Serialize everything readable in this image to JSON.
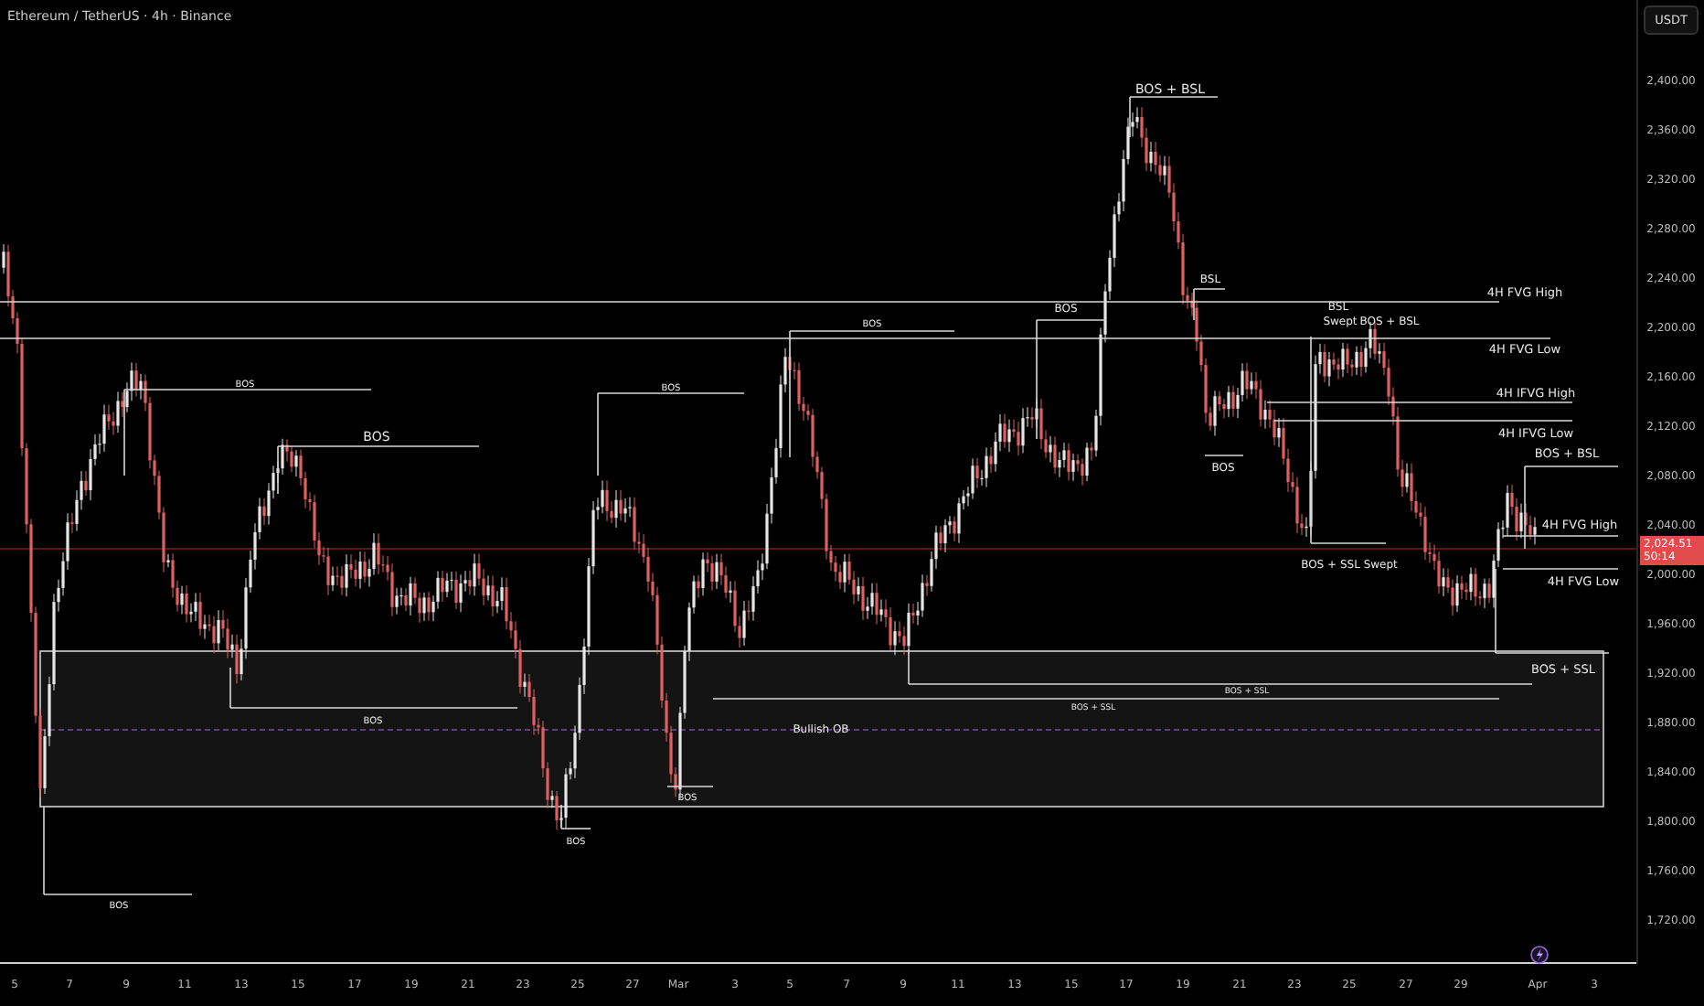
{
  "header": {
    "title": "Ethereum / TetherUS · 4h · Binance"
  },
  "currency_button": "USDT",
  "price_axis": [
    "2,400.00",
    "2,360.00",
    "2,320.00",
    "2,280.00",
    "2,240.00",
    "2,200.00",
    "2,160.00",
    "2,120.00",
    "2,080.00",
    "2,040.00",
    "2,000.00",
    "1,960.00",
    "1,920.00",
    "1,880.00",
    "1,840.00",
    "1,800.00",
    "1,760.00",
    "1,720.00"
  ],
  "last_price": {
    "price": "2,024.51",
    "countdown": "50:14"
  },
  "date_axis": [
    "5",
    "7",
    "9",
    "11",
    "13",
    "15",
    "17",
    "19",
    "21",
    "23",
    "25",
    "27",
    "Mar",
    "3",
    "5",
    "7",
    "9",
    "11",
    "13",
    "15",
    "17",
    "19",
    "21",
    "23",
    "25",
    "27",
    "29",
    "Apr",
    "3"
  ],
  "order_block": {
    "label": "Bullish OB"
  },
  "annotations": [
    {
      "label": "BOS + BSL"
    },
    {
      "label": "BSL"
    },
    {
      "label": "4H FVG High"
    },
    {
      "label": "BOS"
    },
    {
      "label": "BOS"
    },
    {
      "label": "BSL"
    },
    {
      "label": "Swept"
    },
    {
      "label": "BOS + BSL"
    },
    {
      "label": "4H FVG Low"
    },
    {
      "label": "BOS"
    },
    {
      "label": "BOS"
    },
    {
      "label": "4H IFVG High"
    },
    {
      "label": "4H IFVG Low"
    },
    {
      "label": "BOS"
    },
    {
      "label": "BOS + BSL"
    },
    {
      "label": "BOS"
    },
    {
      "label": "4H FVG High"
    },
    {
      "label": "BOS + SSL Swept"
    },
    {
      "label": "4H FVG Low"
    },
    {
      "label": "BOS + SSL"
    },
    {
      "label": "BOS + SSL"
    },
    {
      "label": "BOS + SSL"
    },
    {
      "label": "BOS"
    },
    {
      "label": "BOS"
    },
    {
      "label": "BOS"
    },
    {
      "label": "BOS"
    }
  ]
}
